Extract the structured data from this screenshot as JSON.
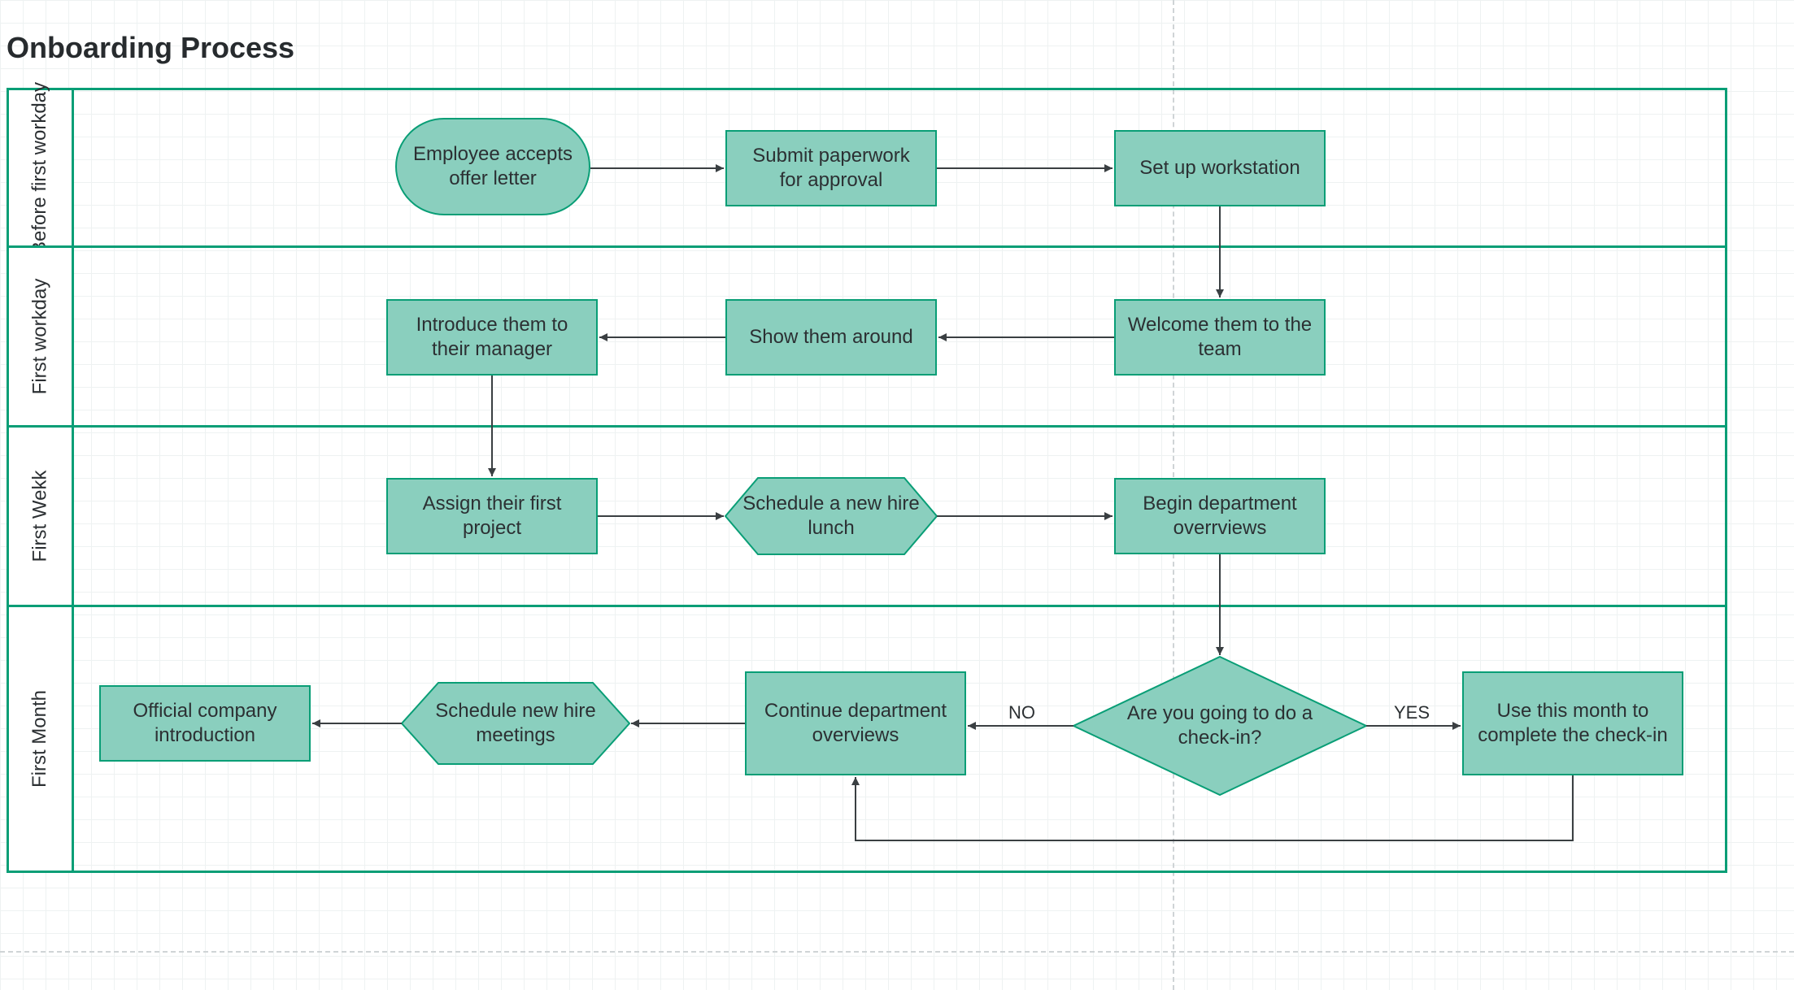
{
  "title": "Onboarding Process",
  "lanes": {
    "before": {
      "label": "Before first workday"
    },
    "first_day": {
      "label": "First workday"
    },
    "first_week": {
      "label": "First Wekk"
    },
    "first_month": {
      "label": "First Month"
    }
  },
  "nodes": {
    "accept": "Employee accepts offer letter",
    "paperwork": "Submit paperwork for approval",
    "workstation": "Set up workstation",
    "welcome": "Welcome them to the team",
    "tour": "Show them around",
    "manager": "Introduce them to their manager",
    "assign": "Assign their first project",
    "lunch": "Schedule a new hire lunch",
    "dept_begin": "Begin department overrviews",
    "decision": "Are you going to do a check-in?",
    "checkin": "Use this month to complete the check-in",
    "dept_cont": "Continue department overviews",
    "meetings": "Schedule new hire meetings",
    "intro": "Official company introduction"
  },
  "edges": {
    "no": "NO",
    "yes": "YES"
  },
  "colors": {
    "lane_border": "#099e76",
    "node_fill": "#8acfbe",
    "node_border": "#099e76",
    "text": "#2c3033",
    "arrow": "#3a3f42"
  }
}
